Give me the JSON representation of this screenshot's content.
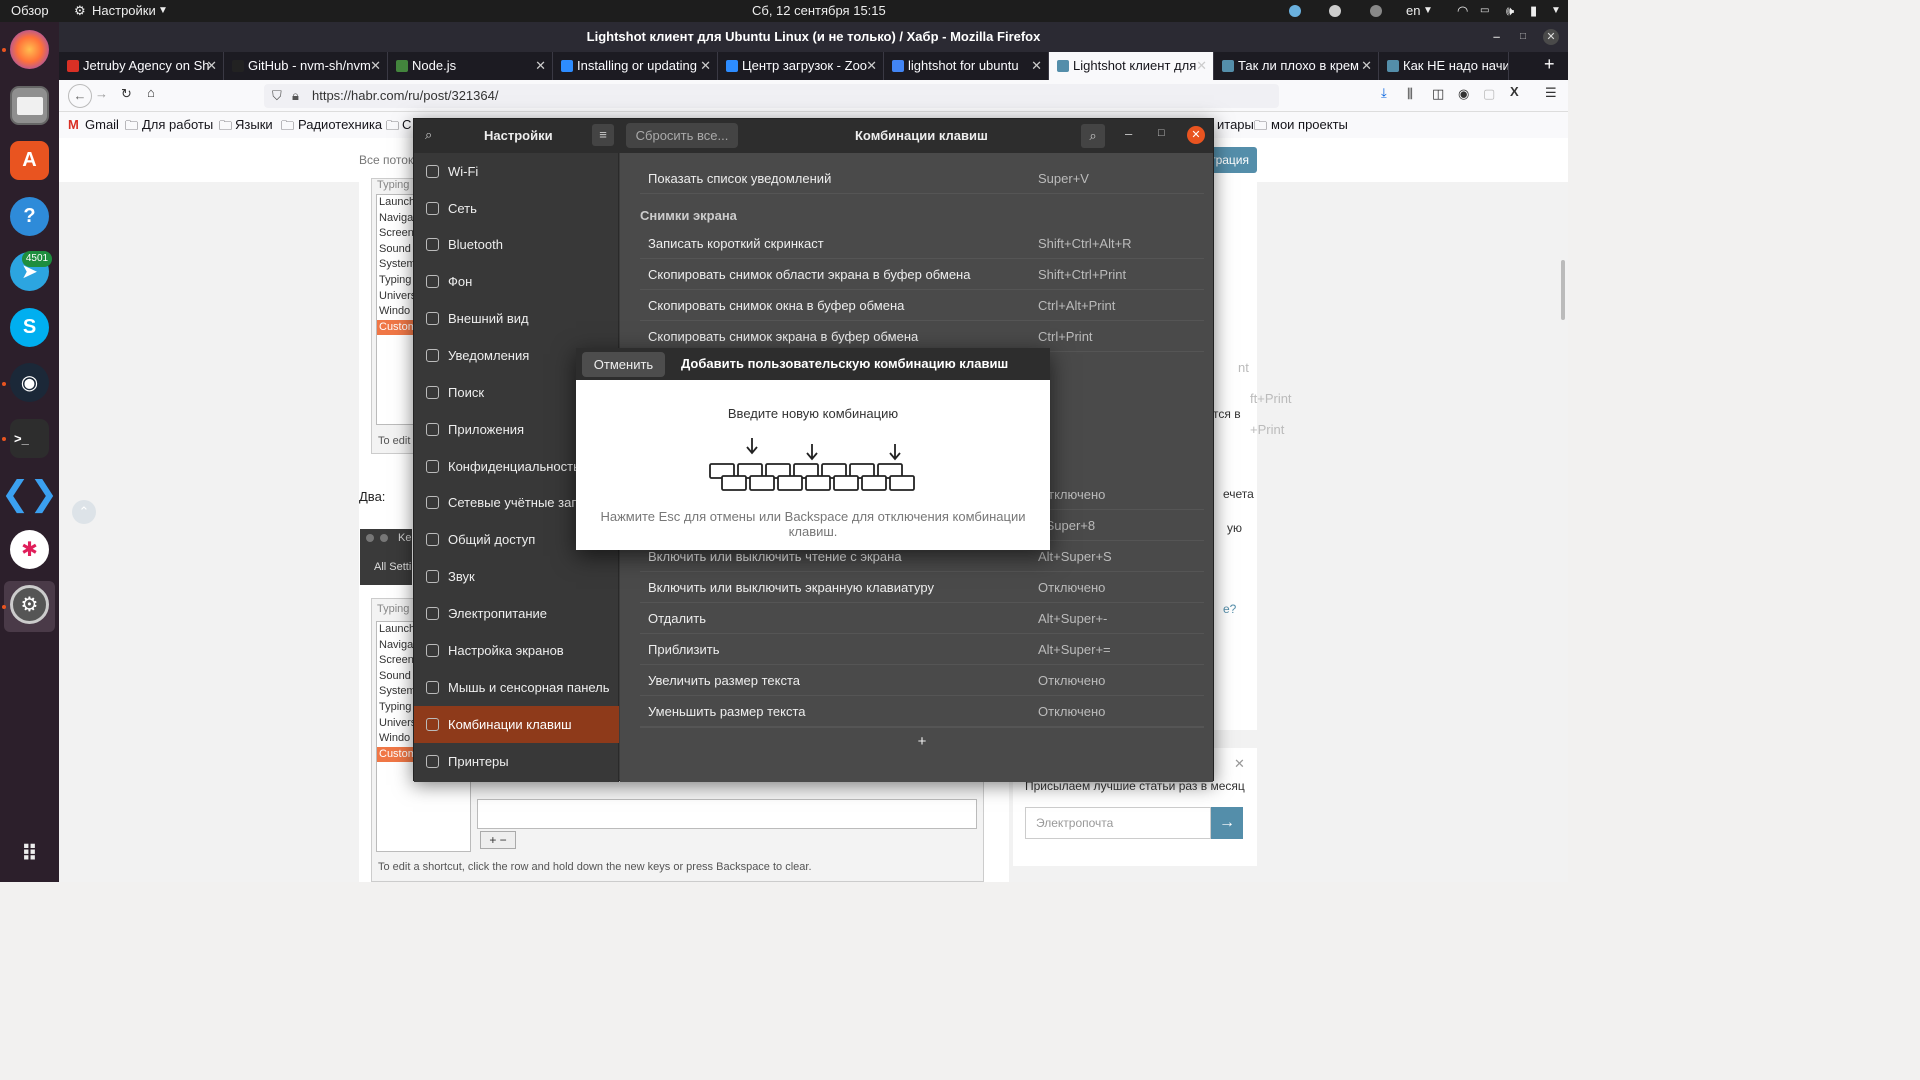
{
  "topbar": {
    "overview": "Обзор",
    "app_menu": "Настройки",
    "datetime": "Сб, 12 сентября  15:15",
    "lang": "en"
  },
  "dock": {
    "telegram_badge": "4501"
  },
  "firefox": {
    "window_title": "Lightshot клиент для Ubuntu Linux (и не только) / Хабр - Mozilla Firefox",
    "tabs": [
      {
        "label": "Jetruby Agency on Sh",
        "color": "#d93025"
      },
      {
        "label": "GitHub - nvm-sh/nvm",
        "color": "#222222"
      },
      {
        "label": "Node.js",
        "color": "#43853d"
      },
      {
        "label": "Installing or updating",
        "color": "#2d8cff"
      },
      {
        "label": "Центр загрузок - Zoo",
        "color": "#2d8cff"
      },
      {
        "label": "lightshot for ubuntu",
        "color": "#4285f4"
      },
      {
        "label": "Lightshot клиент для",
        "color": "#548eaa"
      },
      {
        "label": "Так ли плохо в крем",
        "color": "#548eaa"
      },
      {
        "label": "Как НЕ надо начинат",
        "color": "#548eaa"
      }
    ],
    "url": "https://habr.com/ru/post/321364/",
    "bookmarks": [
      "Gmail",
      "Для работы",
      "Языки",
      "Радиотехника",
      "C",
      "итары",
      "мои проекты"
    ]
  },
  "page": {
    "all_streams": "Все поток",
    "register_btn": "трация",
    "left_list_header": "Typing",
    "left_list_items": [
      "Launch",
      "Naviga",
      "Screen",
      "Sound",
      "System",
      "Typing",
      "Univers",
      "Windo",
      "Custom"
    ],
    "left_list_items2": [
      "Launch",
      "Naviga",
      "Screen",
      "Sound",
      "System",
      "Typing",
      "Univers",
      "Windo",
      "Custom"
    ],
    "to_edit_short": "To edit",
    "dva": "Два:",
    "kb_title": "Ke",
    "all_settings": "All Setti",
    "to_edit_long": "To edit a shortcut, click the row and hold down the new keys or press Backspace to clear.",
    "right_snippets": [
      "тся в",
      "ечета",
      "ую",
      "e?"
    ],
    "newsletter_text": "Присылаем лучшие статьи раз в месяц",
    "email_placeholder": "Электропочта"
  },
  "settings": {
    "title_left": "Настройки",
    "reset_btn": "Сбросить все...",
    "title_right": "Комбинации клавиш",
    "sidebar": [
      {
        "label": "Wi-Fi",
        "icon": "wifi-icon"
      },
      {
        "label": "Сеть",
        "icon": "network-icon"
      },
      {
        "label": "Bluetooth",
        "icon": "bluetooth-icon"
      },
      {
        "label": "Фон",
        "icon": "background-icon"
      },
      {
        "label": "Внешний вид",
        "icon": "appearance-icon"
      },
      {
        "label": "Уведомления",
        "icon": "bell-icon"
      },
      {
        "label": "Поиск",
        "icon": "search-icon"
      },
      {
        "label": "Приложения",
        "icon": "apps-icon"
      },
      {
        "label": "Конфиденциальность",
        "icon": "lock-icon"
      },
      {
        "label": "Сетевые учётные запис",
        "icon": "cloud-icon"
      },
      {
        "label": "Общий доступ",
        "icon": "share-icon"
      },
      {
        "label": "Звук",
        "icon": "music-icon"
      },
      {
        "label": "Электропитание",
        "icon": "power-icon"
      },
      {
        "label": "Настройка экранов",
        "icon": "display-icon"
      },
      {
        "label": "Мышь и сенсорная панель",
        "icon": "mouse-icon"
      },
      {
        "label": "Комбинации клавиш",
        "icon": "keyboard-icon"
      },
      {
        "label": "Принтеры",
        "icon": "printer-icon"
      }
    ],
    "selected_index": 15,
    "row_top": {
      "name": "Показать список уведомлений",
      "key": "Super+V"
    },
    "section_screenshots": "Снимки экрана",
    "screenshot_rows": [
      {
        "name": "Записать короткий скринкаст",
        "key": "Shift+Ctrl+Alt+R"
      },
      {
        "name": "Скопировать снимок области экрана в буфер обмена",
        "key": "Shift+Ctrl+Print"
      },
      {
        "name": "Скопировать снимок окна в буфер обмена",
        "key": "Ctrl+Alt+Print"
      },
      {
        "name": "Скопировать снимок экрана в буфер обмена",
        "key": "Ctrl+Print"
      }
    ],
    "partial_keys": [
      "nt",
      "ft+Print",
      "+Print"
    ],
    "access_rows": [
      {
        "name": "",
        "key": "Отключено"
      },
      {
        "name": "",
        "key": "+Super+8"
      },
      {
        "name": "Включить или выключить чтение с экрана",
        "key": "Alt+Super+S"
      },
      {
        "name": "Включить или выключить экранную клавиатуру",
        "key": "Отключено"
      },
      {
        "name": "Отдалить",
        "key": "Alt+Super+-"
      },
      {
        "name": "Приблизить",
        "key": "Alt+Super+="
      },
      {
        "name": "Увеличить размер текста",
        "key": "Отключено"
      },
      {
        "name": "Уменьшить размер текста",
        "key": "Отключено"
      }
    ],
    "add_btn": "+"
  },
  "dialog": {
    "cancel": "Отменить",
    "title": "Добавить пользовательскую комбинацию клавиш",
    "prompt": "Введите новую комбинацию",
    "hint": "Нажмите Esc для отмены или Backspace для отключения комбинации клавиш."
  }
}
